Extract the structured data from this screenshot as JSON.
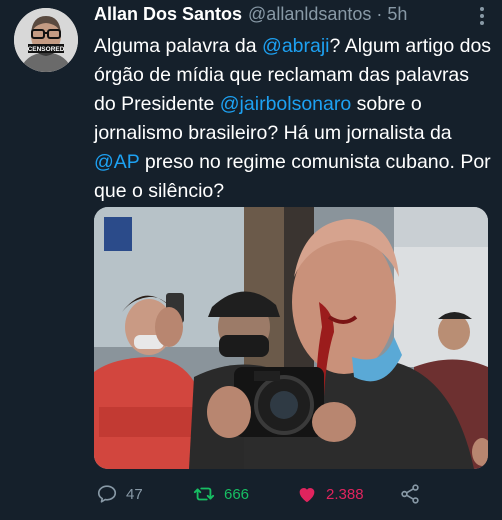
{
  "tweet": {
    "author_name": "Allan Dos Santos",
    "handle": "@allanldsantos",
    "separator": "·",
    "time": "5h",
    "avatar_badge": "CENSORED",
    "text_parts": [
      "Alguma palavra da ",
      "@abraji",
      "? Algum artigo dos órgão de mídia que reclamam das palavras do Presidente ",
      "@jairbolsonaro",
      " sobre o jornalismo brasileiro? Há um jornalista da ",
      "@AP",
      " preso no regime comunista cubano. Por que o silêncio?"
    ],
    "actions": {
      "reply_count": "47",
      "retweet_count": "666",
      "like_count": "2.388"
    }
  },
  "icons": {
    "more": "more-vertical-icon",
    "reply": "comment-bubble-icon",
    "retweet": "retweet-arrows-icon",
    "like": "heart-filled-icon",
    "share": "share-nodes-icon"
  },
  "colors": {
    "background": "#15202b",
    "text": "#ffffff",
    "secondary": "#8899a6",
    "mention": "#1da1f2",
    "retweet": "#17bf63",
    "like": "#e0245e"
  }
}
